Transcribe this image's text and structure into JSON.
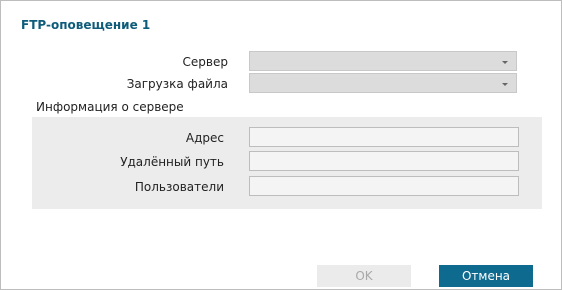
{
  "dialog": {
    "title": "FTP-оповещение 1"
  },
  "server": {
    "label": "Сервер",
    "value": ""
  },
  "file_upload": {
    "label": "Загрузка файла",
    "value": ""
  },
  "server_info": {
    "section_label": "Информация о сервере",
    "fields": [
      {
        "label": "Адрес",
        "value": ""
      },
      {
        "label": "Удалённый путь",
        "value": ""
      },
      {
        "label": "Пользователи",
        "value": ""
      }
    ]
  },
  "buttons": {
    "ok_label": "OK",
    "cancel_label": "Отмена"
  },
  "colors": {
    "accent": "#0f6a8f",
    "title": "#0f5c7a",
    "panel": "#ececec"
  },
  "icons": {
    "dropdown": "chevron-down-icon"
  }
}
